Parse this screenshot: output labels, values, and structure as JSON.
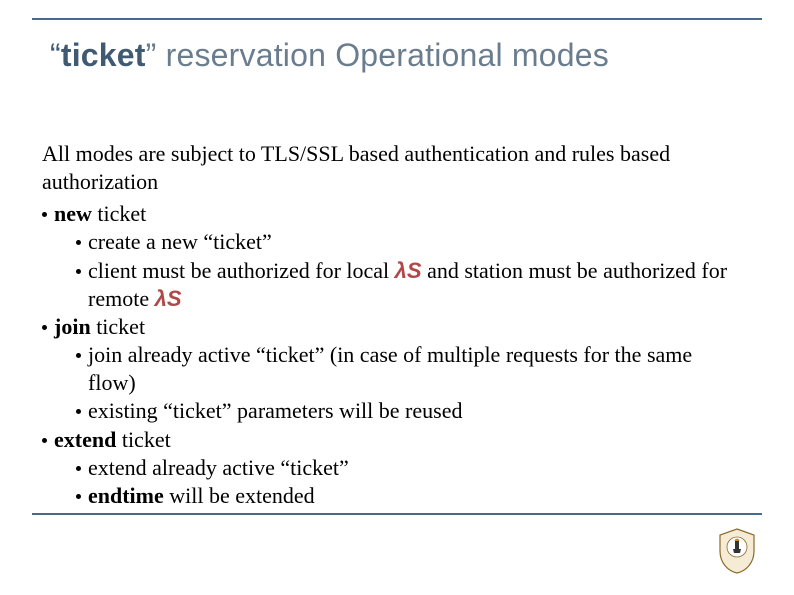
{
  "title": {
    "quote_open": "“",
    "word": "ticket",
    "quote_close": "”",
    "rest": " reservation Operational modes"
  },
  "intro": "All modes are subject to TLS/SSL based authentication and rules based authorization",
  "items": [
    {
      "label_pre": "new",
      "label_post": " ticket",
      "children": [
        {
          "pre": "create a new “ticket”",
          "ls": "",
          "post": ""
        },
        {
          "pre": "client must be authorized for local ",
          "ls": "λS",
          "post": " and station must be authorized for remote ",
          "ls2": "λS"
        }
      ]
    },
    {
      "label_pre": " join",
      "label_post": " ticket",
      "children": [
        {
          "pre": "join already active “ticket” (in case of multiple requests for the same flow)",
          "ls": "",
          "post": ""
        },
        {
          "pre": "existing “ticket” parameters will be reused",
          "ls": "",
          "post": ""
        }
      ]
    },
    {
      "label_pre": " extend",
      "label_post": " ticket",
      "children": [
        {
          "pre": "extend already active  “ticket”",
          "ls": "",
          "post": ""
        },
        {
          "pre_bold": "endtime",
          "pre": " will be extended",
          "ls": "",
          "post": ""
        }
      ]
    }
  ]
}
